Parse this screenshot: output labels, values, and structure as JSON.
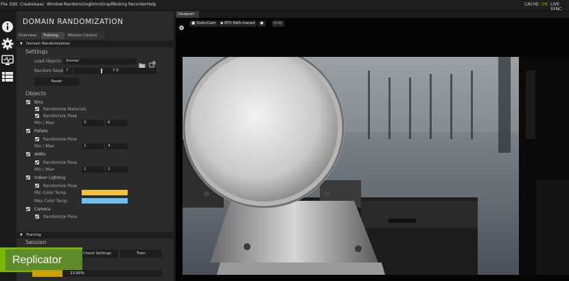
{
  "menubar": {
    "items": [
      "File",
      "Edit",
      "Create",
      "Isaac",
      "Window",
      "Randomizing",
      "OmniGraph",
      "Testing",
      "Recorder",
      "Help"
    ],
    "cache_label": "CACHE:",
    "cache_state": "ON",
    "live_sync": "LIVE SYNC"
  },
  "sidebar": {
    "icons": [
      "info-icon",
      "gear-icon",
      "monitor-icon",
      "grid-icon"
    ]
  },
  "panel": {
    "title": "DOMAIN RANDOMIZATION",
    "tabs": [
      {
        "label": "Overview"
      },
      {
        "label": "Training"
      },
      {
        "label": "Mission Control"
      }
    ],
    "active_tab": "Training",
    "section_dr": "Domain Randomization",
    "settings_header": "Settings",
    "load_objects_label": "Load Objects",
    "load_objects_value": "/home/",
    "random_seed_label": "Random Seed",
    "random_seed_value": "7",
    "random_seed_slider": "7.0",
    "reset_label": "Reset",
    "objects_header": "Objects",
    "bins": {
      "label": "Bins",
      "randomize_materials": "Randomize Materials",
      "randomize_pose": "Randomize Pose",
      "minmax_label": "Min / Max",
      "min": "3",
      "max": "6"
    },
    "pallets": {
      "label": "Pallets",
      "randomize_pose": "Randomize Pose",
      "minmax_label": "Min / Max",
      "min": "1",
      "max": "4"
    },
    "amrs": {
      "label": "AMRs",
      "randomize_pose": "Randomize Pose",
      "minmax_label": "Min / Max",
      "min": "1",
      "max": "2"
    },
    "indoor_lighting": {
      "label": "Indoor Lighting",
      "randomize_pose": "Randomize Pose",
      "min_color_label": "Min Color Temp",
      "max_color_label": "Max Color Temp",
      "min_color": "#f5c33b",
      "max_color": "#6ec0f0"
    },
    "camera": {
      "label": "Camera",
      "randomize_pose": "Randomize Pose"
    },
    "section_training": "Training",
    "session_header": "Session",
    "check_settings_label": "Check Settings",
    "train_label": "Train",
    "progress_text": "23.00%",
    "progress_value": 0.23
  },
  "viewport": {
    "tab_label": "Viewport",
    "toolbar": {
      "camera": "StaticCam",
      "render_mode": "RTX Path-traced"
    }
  },
  "badge": {
    "label": "Replicator"
  },
  "colors": {
    "accent": "#76b900",
    "progress": "#c9a100"
  }
}
